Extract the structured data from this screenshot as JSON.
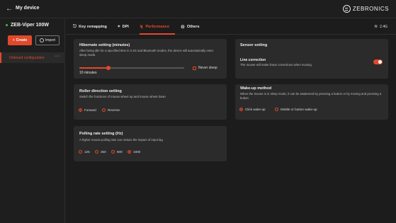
{
  "header": {
    "back_icon": "arrow-left-icon",
    "title": "My device",
    "brand": "ZEBRONICS"
  },
  "sidebar": {
    "device_name": "ZEB-Viper 100W",
    "create_label": "Create",
    "import_label": "Import",
    "items": [
      {
        "label": "Onboard configuration",
        "more": "···"
      }
    ]
  },
  "tabs": [
    {
      "label": "Key remapping",
      "icon": "mouse-icon"
    },
    {
      "label": "DPI",
      "icon": "crosshair-icon"
    },
    {
      "label": "Performance",
      "icon": "performance-icon",
      "active": true
    },
    {
      "label": "Others",
      "icon": "gear-icon"
    }
  ],
  "connection": {
    "label": "2.4G",
    "icon": "wifi-icon"
  },
  "hibernate": {
    "title": "Hibernate setting  (minutes)",
    "desc": "After being idle for a specified time in 2.4G and Bluetooth modes, the device will automatically enter sleep mode.",
    "value_label": "10 minutes",
    "slider_fraction": 0.28,
    "never_sleep_label": "Never sleep"
  },
  "roller": {
    "title": "Roller direction setting",
    "desc": "Switch the functions of mouse wheel up and mouse wheel down",
    "options": [
      {
        "label": "Forward",
        "selected": true
      },
      {
        "label": "Reverse",
        "selected": false
      }
    ]
  },
  "polling": {
    "title": "Polling rate setting  (Hz)",
    "desc": "A higher mouse polling rate can reduce the impact of input lag",
    "options": [
      {
        "label": "125",
        "selected": false
      },
      {
        "label": "250",
        "selected": false
      },
      {
        "label": "500",
        "selected": false
      },
      {
        "label": "1000",
        "selected": true
      }
    ]
  },
  "sensor": {
    "title": "Sensor setting",
    "line_correction_title": "Line correction",
    "line_correction_desc": "The mouse will make linear corrections when moving",
    "line_correction_on": true
  },
  "wakeup": {
    "title": "Wake-up method",
    "desc": "When the mouse is in sleep mode, it can be awakened by pressing a button or by moving and pressing a button",
    "options": [
      {
        "label": "Click wake-up",
        "selected": true
      },
      {
        "label": "Mobile or button wake-up",
        "selected": false
      }
    ]
  },
  "colors": {
    "accent": "#e2492b",
    "background": "#1c1c1c",
    "card": "#2b2b2b",
    "status_dot": "#35c24a"
  }
}
